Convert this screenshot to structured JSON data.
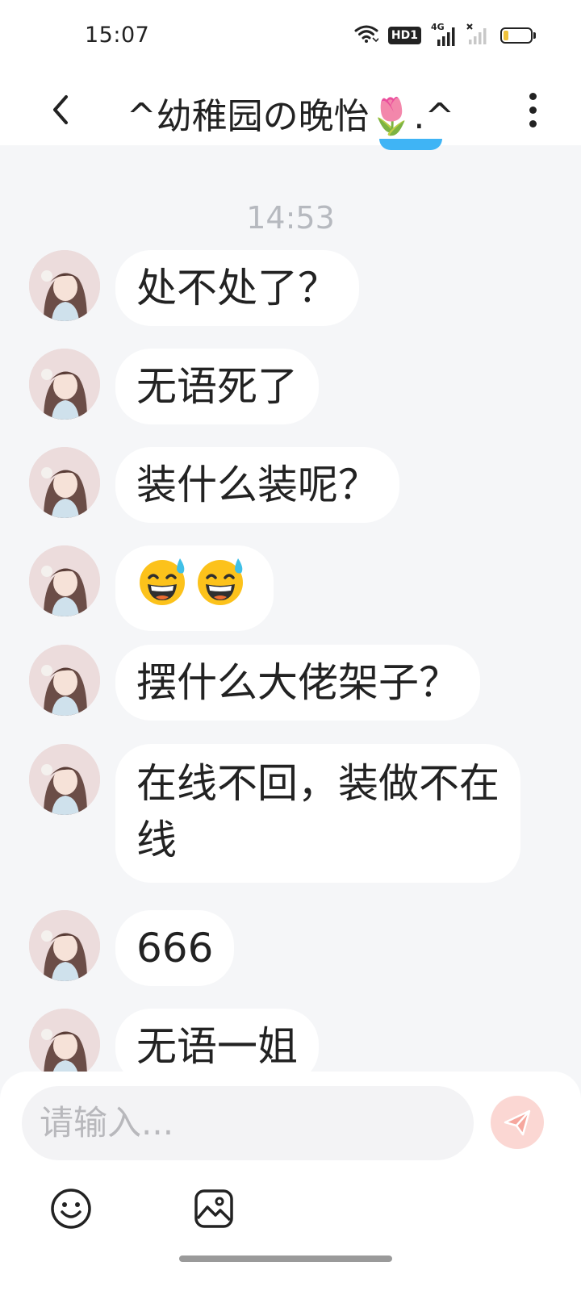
{
  "status_bar": {
    "time": "15:07",
    "hd_badge": "HD1",
    "network_label": "4G",
    "icons": [
      "wifi-icon",
      "hd-voice-icon",
      "signal-4g-icon",
      "signal-no-service-icon",
      "battery-icon"
    ],
    "battery_level": 0.1,
    "battery_color": "#f0c23a"
  },
  "header": {
    "back_icon": "chevron-left-icon",
    "title": "^幼稚园の晚怡🌷.^",
    "menu_icon": "more-vertical-icon"
  },
  "chat": {
    "timestamp": "14:53",
    "messages": [
      {
        "text": "处不处了？"
      },
      {
        "text": "无语死了"
      },
      {
        "text": "装什么装呢？"
      },
      {
        "emoji_count": 2,
        "emoji": "grinning-face-with-sweat"
      },
      {
        "text": "摆什么大佬架子？"
      },
      {
        "text": "在线不回，装做不在线"
      },
      {
        "text": "666"
      },
      {
        "text": "无语一姐"
      }
    ]
  },
  "composer": {
    "placeholder": "请输入...",
    "send_icon": "send-icon",
    "send_color": "#f08a7e",
    "tools": [
      "emoji-icon",
      "image-icon"
    ]
  }
}
